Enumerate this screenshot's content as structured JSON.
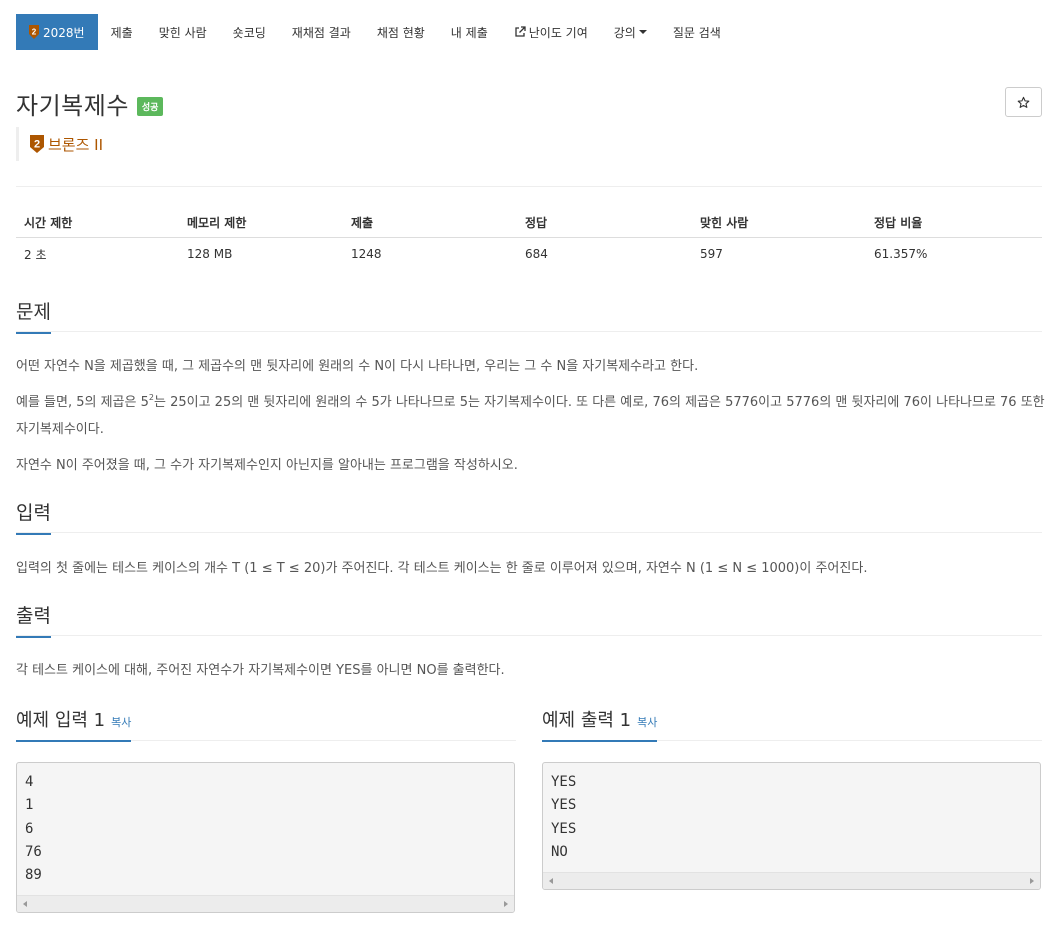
{
  "nav": {
    "items": [
      {
        "label": "2028번",
        "icon": "bronze-medal-icon",
        "active": true
      },
      {
        "label": "제출"
      },
      {
        "label": "맞힌 사람"
      },
      {
        "label": "숏코딩"
      },
      {
        "label": "재채점 결과"
      },
      {
        "label": "채점 현황"
      },
      {
        "label": "내 제출"
      },
      {
        "label": "난이도 기여",
        "icon": "external-link-icon"
      },
      {
        "label": "강의",
        "icon": "caret-down-icon"
      },
      {
        "label": "질문 검색"
      }
    ]
  },
  "problem": {
    "title": "자기복제수",
    "status_badge": "성공",
    "tier": "브론즈 II",
    "tier_icon": "bronze-2-medal-icon",
    "star_icon": "star-outline-icon"
  },
  "stats": {
    "headers": [
      "시간 제한",
      "메모리 제한",
      "제출",
      "정답",
      "맞힌 사람",
      "정답 비율"
    ],
    "values": [
      "2 초",
      "128 MB",
      "1248",
      "684",
      "597",
      "61.357%"
    ]
  },
  "sections": {
    "problem": {
      "heading": "문제",
      "p1": "어떤 자연수 N을 제곱했을 때, 그 제곱수의 맨 뒷자리에 원래의 수 N이 다시 나타나면, 우리는 그 수 N을 자기복제수라고 한다.",
      "p2_a": "예를 들면, 5의 제곱은 5",
      "p2_sup": "2",
      "p2_b": "는 25이고 25의 맨 뒷자리에 원래의 수 5가 나타나므로 5는 자기복제수이다. 또 다른 예로, 76의 제곱은 5776이고 5776의 맨 뒷자리에 76이 나타나므로 76 또한 자기복제수이다.",
      "p3": "자연수 N이 주어졌을 때, 그 수가 자기복제수인지 아닌지를 알아내는 프로그램을 작성하시오."
    },
    "input": {
      "heading": "입력",
      "p1": "입력의 첫 줄에는 테스트 케이스의 개수 T (1 ≤ T ≤ 20)가 주어진다. 각 테스트 케이스는 한 줄로 이루어져 있으며, 자연수 N (1 ≤ N ≤ 1000)이 주어진다."
    },
    "output": {
      "heading": "출력",
      "p1": "각 테스트 케이스에 대해, 주어진 자연수가 자기복제수이면 YES를 아니면 NO를 출력한다."
    }
  },
  "samples": {
    "input": {
      "title": "예제 입력 1",
      "copy": "복사",
      "lines": [
        "4",
        "1",
        "6",
        "76",
        "89"
      ]
    },
    "output": {
      "title": "예제 출력 1",
      "copy": "복사",
      "lines": [
        "YES",
        "YES",
        "YES",
        "NO"
      ]
    }
  },
  "colors": {
    "primary": "#337ab7",
    "success": "#5cb85c",
    "bronze": "#ad5600"
  }
}
